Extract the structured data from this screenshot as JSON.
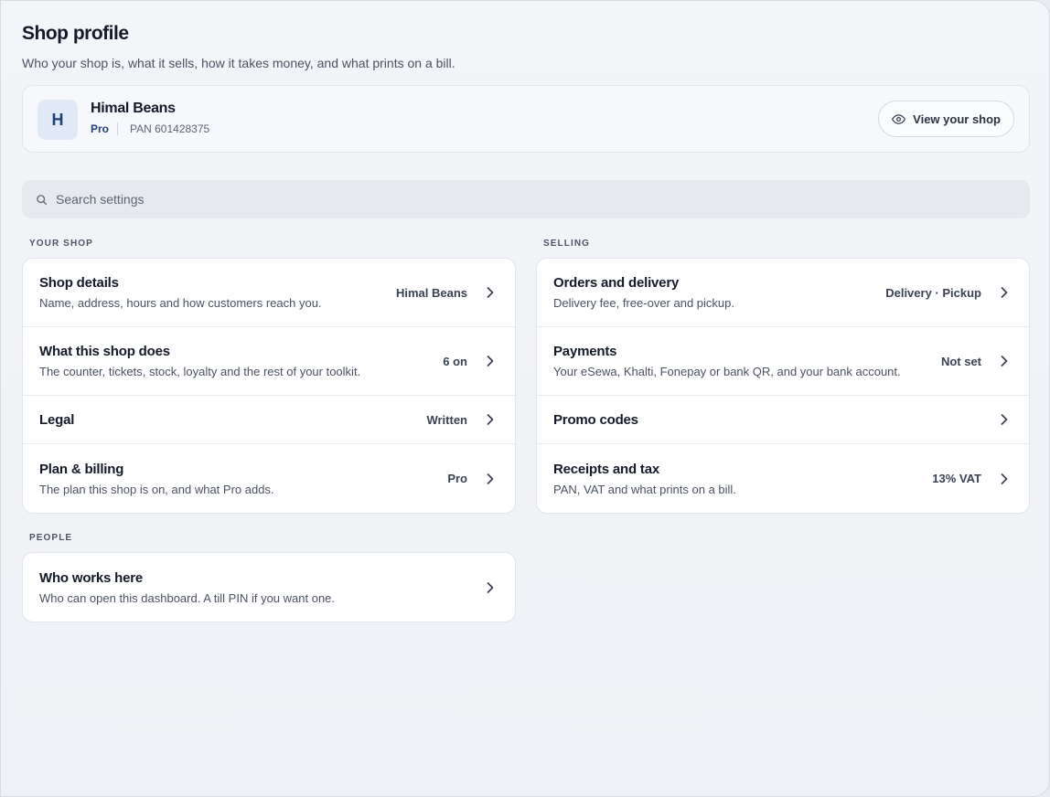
{
  "header": {
    "title": "Shop profile",
    "subtitle": "Who your shop is, what it sells, how it takes money, and what prints on a bill."
  },
  "shop": {
    "initial": "H",
    "name": "Himal Beans",
    "plan": "Pro",
    "pan": "PAN 601428375",
    "view_button": "View your shop"
  },
  "search": {
    "placeholder": "Search settings"
  },
  "sections": {
    "your_shop": {
      "label": "YOUR SHOP",
      "items": [
        {
          "title": "Shop details",
          "desc": "Name, address, hours and how customers reach you.",
          "value": "Himal Beans"
        },
        {
          "title": "What this shop does",
          "desc": "The counter, tickets, stock, loyalty and the rest of your toolkit.",
          "value": "6 on"
        },
        {
          "title": "Legal",
          "value": "Written"
        },
        {
          "title": "Plan & billing",
          "desc": "The plan this shop is on, and what Pro adds.",
          "value": "Pro"
        }
      ]
    },
    "selling": {
      "label": "SELLING",
      "items": [
        {
          "title": "Orders and delivery",
          "desc": "Delivery fee, free-over and pickup.",
          "value": "Delivery · Pickup"
        },
        {
          "title": "Payments",
          "desc": "Your eSewa, Khalti, Fonepay or bank QR, and your bank account.",
          "value": "Not set"
        },
        {
          "title": "Promo codes"
        },
        {
          "title": "Receipts and tax",
          "desc": "PAN, VAT and what prints on a bill.",
          "value": "13% VAT"
        }
      ]
    },
    "people": {
      "label": "PEOPLE",
      "items": [
        {
          "title": "Who works here",
          "desc": "Who can open this dashboard. A till PIN if you want one."
        }
      ]
    }
  },
  "icons": {
    "search": "search-icon",
    "eye": "eye-icon",
    "chevron": "chevron-right-icon"
  },
  "colors": {
    "accent": "#1f3f7a",
    "background": "#eef1f5",
    "card": "#ffffff"
  }
}
